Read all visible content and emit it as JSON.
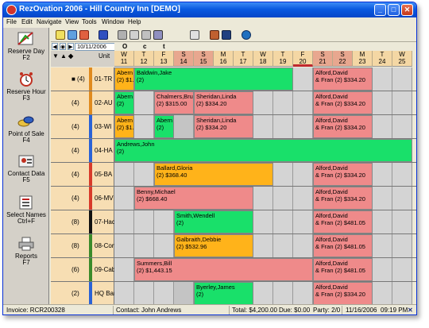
{
  "window": {
    "title": "RezOvation 2006 - Hill Country Inn [DEMO]",
    "minimize": "_",
    "maximize": "□",
    "close": "✕"
  },
  "menu": [
    "File",
    "Edit",
    "Navigate",
    "View",
    "Tools",
    "Window",
    "Help"
  ],
  "sidebar": [
    {
      "label": "Reserve Day",
      "shortcut": "F2",
      "icon": "reserve-day-icon"
    },
    {
      "label": "Reserve Hour",
      "shortcut": "F3",
      "icon": "alarm-clock-icon"
    },
    {
      "label": "Point of Sale",
      "shortcut": "F4",
      "icon": "coins-icon"
    },
    {
      "label": "Contact Data",
      "shortcut": "F5",
      "icon": "contact-card-icon"
    },
    {
      "label": "Select Names",
      "shortcut": "Ctrl+F",
      "icon": "name-list-icon"
    },
    {
      "label": "Reports",
      "shortcut": "F7",
      "icon": "printer-icon"
    }
  ],
  "date_nav": {
    "date": "10/11/2006",
    "unit_label": "Unit"
  },
  "calendar": {
    "month_letters": [
      "O",
      "c",
      "t"
    ],
    "days": [
      {
        "dow": "W",
        "num": "11"
      },
      {
        "dow": "T",
        "num": "12"
      },
      {
        "dow": "F",
        "num": "13"
      },
      {
        "dow": "S",
        "num": "14"
      },
      {
        "dow": "S",
        "num": "15"
      },
      {
        "dow": "M",
        "num": "16"
      },
      {
        "dow": "T",
        "num": "17"
      },
      {
        "dow": "W",
        "num": "18"
      },
      {
        "dow": "T",
        "num": "19"
      },
      {
        "dow": "F",
        "num": "20"
      },
      {
        "dow": "S",
        "num": "21"
      },
      {
        "dow": "S",
        "num": "22"
      },
      {
        "dow": "M",
        "num": "23"
      },
      {
        "dow": "T",
        "num": "24"
      },
      {
        "dow": "W",
        "num": "25"
      }
    ],
    "units": [
      {
        "count": "■ (4)",
        "name": "01-TR",
        "color": "#e08a1e"
      },
      {
        "count": "(4)",
        "name": "02-AU",
        "color": "#e08a1e"
      },
      {
        "count": "(4)",
        "name": "03-WI",
        "color": "#2a62d6"
      },
      {
        "count": "(4)",
        "name": "04-HA",
        "color": "#2a62d6"
      },
      {
        "count": "(4)",
        "name": "05-BA",
        "color": "#d83a2a"
      },
      {
        "count": "(4)",
        "name": "06-MV",
        "color": "#d83a2a"
      },
      {
        "count": "(8)",
        "name": "07-Hac",
        "color": "#111111"
      },
      {
        "count": "(8)",
        "name": "08-Con",
        "color": "#3a8a2a"
      },
      {
        "count": "(6)",
        "name": "09-Cab",
        "color": "#3a8a2a"
      },
      {
        "count": "(2)",
        "name": "HQ Bar",
        "color": "#2a62d6"
      }
    ],
    "reservations": [
      {
        "row": 0,
        "start": 0,
        "span": 1,
        "color": "orange",
        "line1": "Abern",
        "line2": "(2) $1."
      },
      {
        "row": 0,
        "start": 1,
        "span": 8,
        "color": "green",
        "line1": "Baldwin,Jake",
        "line2": "(2)"
      },
      {
        "row": 0,
        "start": 10,
        "span": 3,
        "color": "pink",
        "line1": "Alford,David",
        "line2": "& Fran (2) $334.20"
      },
      {
        "row": 1,
        "start": 0,
        "span": 1,
        "color": "green",
        "line1": "Abern",
        "line2": "(2)"
      },
      {
        "row": 1,
        "start": 2,
        "span": 2,
        "color": "pink",
        "line1": "Chalmers,Bruc",
        "line2": "(2) $315.00"
      },
      {
        "row": 1,
        "start": 4,
        "span": 3,
        "color": "pink",
        "line1": "Sheridan,Linda",
        "line2": "(2) $334.20"
      },
      {
        "row": 1,
        "start": 10,
        "span": 3,
        "color": "pink",
        "line1": "Alford,David",
        "line2": "& Fran (2) $334.20"
      },
      {
        "row": 2,
        "start": 0,
        "span": 1,
        "color": "orange",
        "line1": "Abern",
        "line2": "(2) $1."
      },
      {
        "row": 2,
        "start": 2,
        "span": 1,
        "color": "green",
        "line1": "Abern",
        "line2": "(2)"
      },
      {
        "row": 2,
        "start": 4,
        "span": 3,
        "color": "pink",
        "line1": "Sheridan,Linda",
        "line2": "(2) $334.20"
      },
      {
        "row": 2,
        "start": 10,
        "span": 3,
        "color": "pink",
        "line1": "Alford,David",
        "line2": "& Fran (2) $334.20"
      },
      {
        "row": 3,
        "start": 0,
        "span": 15,
        "color": "green",
        "line1": "Andrews,John",
        "line2": "(2)"
      },
      {
        "row": 4,
        "start": 2,
        "span": 6,
        "color": "orange",
        "line1": "Ballard,Gloria",
        "line2": "(2) $368.40"
      },
      {
        "row": 4,
        "start": 10,
        "span": 3,
        "color": "pink",
        "line1": "Alford,David",
        "line2": "& Fran (2) $334.20"
      },
      {
        "row": 5,
        "start": 1,
        "span": 6,
        "color": "pink",
        "line1": "Benny,Michael",
        "line2": "(2) $668.40"
      },
      {
        "row": 5,
        "start": 10,
        "span": 3,
        "color": "pink",
        "line1": "Alford,David",
        "line2": "& Fran (2) $334.20"
      },
      {
        "row": 6,
        "start": 3,
        "span": 4,
        "color": "green",
        "line1": "Smith,Wendell",
        "line2": "(2)"
      },
      {
        "row": 6,
        "start": 10,
        "span": 3,
        "color": "pink",
        "line1": "Alford,David",
        "line2": "& Fran (2) $481.05"
      },
      {
        "row": 7,
        "start": 3,
        "span": 4,
        "color": "orange",
        "line1": "Galbraith,Debbie",
        "line2": "(2) $532.96"
      },
      {
        "row": 7,
        "start": 10,
        "span": 3,
        "color": "pink",
        "line1": "Alford,David",
        "line2": "& Fran (2) $481.05"
      },
      {
        "row": 8,
        "start": 1,
        "span": 9,
        "color": "pink",
        "line1": "Summers,Bill",
        "line2": "(2) $1,443.15"
      },
      {
        "row": 8,
        "start": 10,
        "span": 3,
        "color": "pink",
        "line1": "Alford,David",
        "line2": "& Fran (2) $481.05"
      },
      {
        "row": 9,
        "start": 4,
        "span": 3,
        "color": "green",
        "line1": "Byerley,James",
        "line2": "(2)"
      },
      {
        "row": 9,
        "start": 10,
        "span": 3,
        "color": "pink",
        "line1": "Alford,David",
        "line2": "& Fran (2) $334.20"
      }
    ]
  },
  "status": {
    "invoice": "Invoice: RCR200328",
    "contact": "Contact: John Andrews",
    "total": "Total: $4,200.00",
    "due": "Due: $0.00",
    "party": "Party: 2/0",
    "date": "11/16/2006",
    "time": "09:19 PM",
    "close": "✕"
  }
}
